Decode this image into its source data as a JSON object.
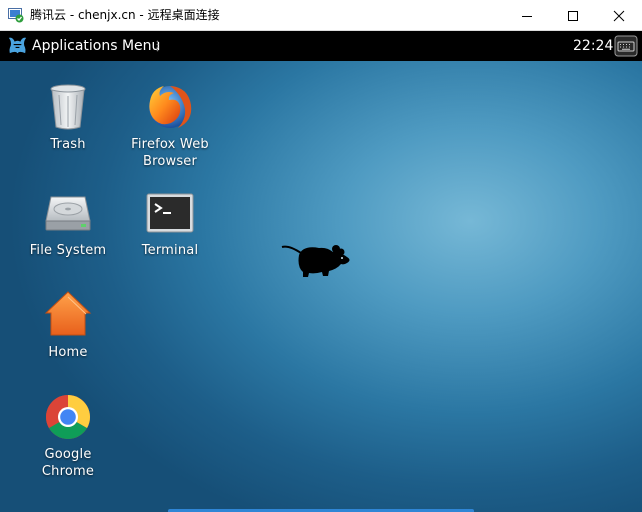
{
  "window": {
    "title": "腾讯云 - chenjx.cn - 远程桌面连接",
    "controls": [
      "minimize",
      "maximize",
      "close"
    ]
  },
  "panel": {
    "applications_menu_label": "Applications Menu",
    "clock": "22:24",
    "tray_icon": "keyboard-icon"
  },
  "desktop": {
    "icons": [
      {
        "label": "Trash",
        "icon": "trash-icon"
      },
      {
        "label": "Firefox Web Browser",
        "icon": "firefox-icon"
      },
      {
        "label": "File System",
        "icon": "drive-icon"
      },
      {
        "label": "Terminal",
        "icon": "terminal-icon"
      },
      {
        "label": "Home",
        "icon": "home-folder-icon"
      },
      {
        "label": "Google Chrome",
        "icon": "chrome-icon"
      }
    ]
  },
  "colors": {
    "desktop_background": "#2b77a3",
    "panel_background": "#000000",
    "titlebar_background": "#ffffff"
  }
}
